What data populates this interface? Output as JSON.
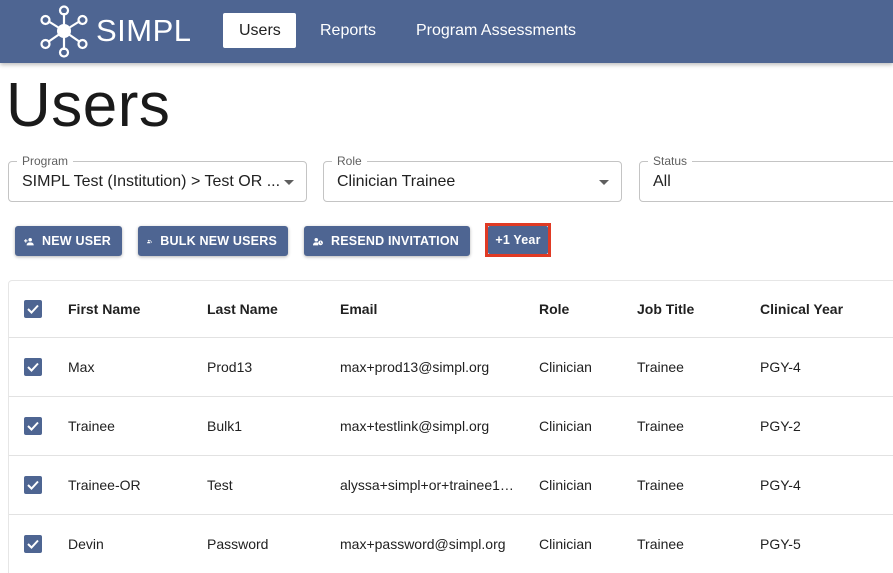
{
  "app": {
    "brand": "SIMPL"
  },
  "nav": {
    "items": [
      {
        "label": "Users",
        "active": true
      },
      {
        "label": "Reports",
        "active": false
      },
      {
        "label": "Program Assessments",
        "active": false
      }
    ]
  },
  "page": {
    "title": "Users"
  },
  "filters": {
    "program": {
      "label": "Program",
      "value": "SIMPL Test (Institution) > Test OR ..."
    },
    "role": {
      "label": "Role",
      "value": "Clinician Trainee"
    },
    "status": {
      "label": "Status",
      "value": "All"
    }
  },
  "actions": {
    "new_user": "NEW USER",
    "bulk_new_users": "BULK NEW USERS",
    "resend_invitation": "RESEND INVITATION",
    "plus_one_year": "+1 Year"
  },
  "table": {
    "columns": [
      "First Name",
      "Last Name",
      "Email",
      "Role",
      "Job Title",
      "Clinical Year"
    ],
    "rows": [
      {
        "first": "Max",
        "last": "Prod13",
        "email": "max+prod13@simpl.org",
        "role": "Clinician",
        "job": "Trainee",
        "year": "PGY-4",
        "checked": true
      },
      {
        "first": "Trainee",
        "last": "Bulk1",
        "email": "max+testlink@simpl.org",
        "role": "Clinician",
        "job": "Trainee",
        "year": "PGY-2",
        "checked": true
      },
      {
        "first": "Trainee-OR",
        "last": "Test",
        "email": "alyssa+simpl+or+trainee1…",
        "role": "Clinician",
        "job": "Trainee",
        "year": "PGY-4",
        "checked": true
      },
      {
        "first": "Devin",
        "last": "Password",
        "email": "max+password@simpl.org",
        "role": "Clinician",
        "job": "Trainee",
        "year": "PGY-5",
        "checked": true
      }
    ]
  },
  "colors": {
    "primary": "#4e6592",
    "highlight": "#e03a24"
  }
}
